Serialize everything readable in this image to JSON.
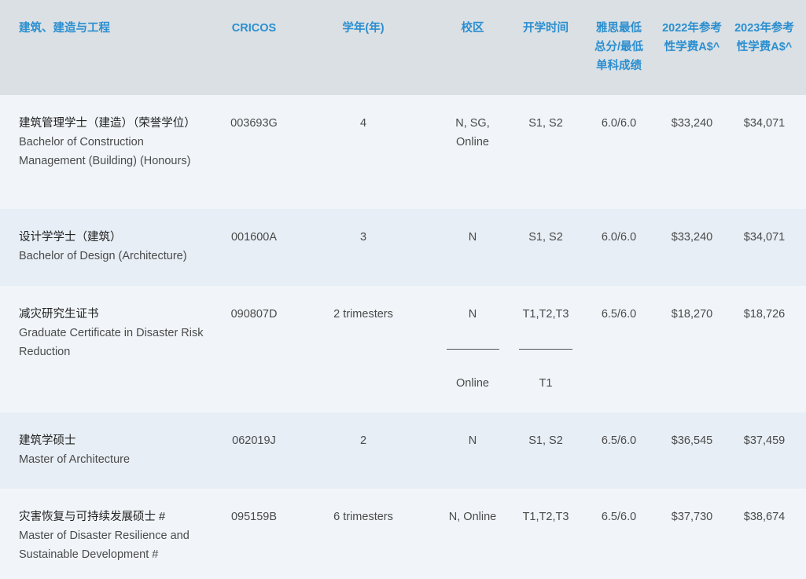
{
  "header": {
    "name": "建筑、建造与工程",
    "cricos": "CRICOS",
    "years": "学年(年)",
    "campus": "校区",
    "intake": "开学时间",
    "ielts": "雅思最低总分/最低单科成绩",
    "fee2022": "2022年参考性学费A$^",
    "fee2023": "2023年参考性学费A$^"
  },
  "rows": [
    {
      "name_zh": "建筑管理学士（建造）（荣誉学位）",
      "name_en": "Bachelor of Construction Management (Building) (Honours)",
      "cricos": "003693G",
      "years": "4",
      "campus": "N, SG, Online",
      "intake": "S1, S2",
      "ielts": "6.0/6.0",
      "fee2022": "$33,240",
      "fee2023": "$34,071"
    },
    {
      "name_zh": "设计学学士（建筑）",
      "name_en": "Bachelor of Design (Architecture)",
      "cricos": "001600A",
      "years": "3",
      "campus": "N",
      "intake": "S1, S2",
      "ielts": "6.0/6.0",
      "fee2022": "$33,240",
      "fee2023": "$34,071"
    },
    {
      "name_zh": "减灾研究生证书",
      "name_en": "Graduate Certificate in Disaster Risk Reduction",
      "cricos": "090807D",
      "years": "2 trimesters",
      "campus": "N",
      "campus_2": "Online",
      "intake": "T1,T2,T3",
      "intake_2": "T1",
      "ielts": "6.5/6.0",
      "fee2022": "$18,270",
      "fee2023": "$18,726"
    },
    {
      "name_zh": "建筑学硕士",
      "name_en": "Master of Architecture",
      "cricos": "062019J",
      "years": "2",
      "campus": "N",
      "intake": "S1, S2",
      "ielts": "6.5/6.0",
      "fee2022": "$36,545",
      "fee2023": "$37,459"
    },
    {
      "name_zh": "灾害恢复与可持续发展硕士 #",
      "name_en": "Master of Disaster Resilience and Sustainable Development #",
      "cricos": "095159B",
      "years": "6 trimesters",
      "campus": "N, Online",
      "intake": "T1,T2,T3",
      "ielts": "6.5/6.0",
      "fee2022": "$37,730",
      "fee2023": "$38,674"
    }
  ]
}
